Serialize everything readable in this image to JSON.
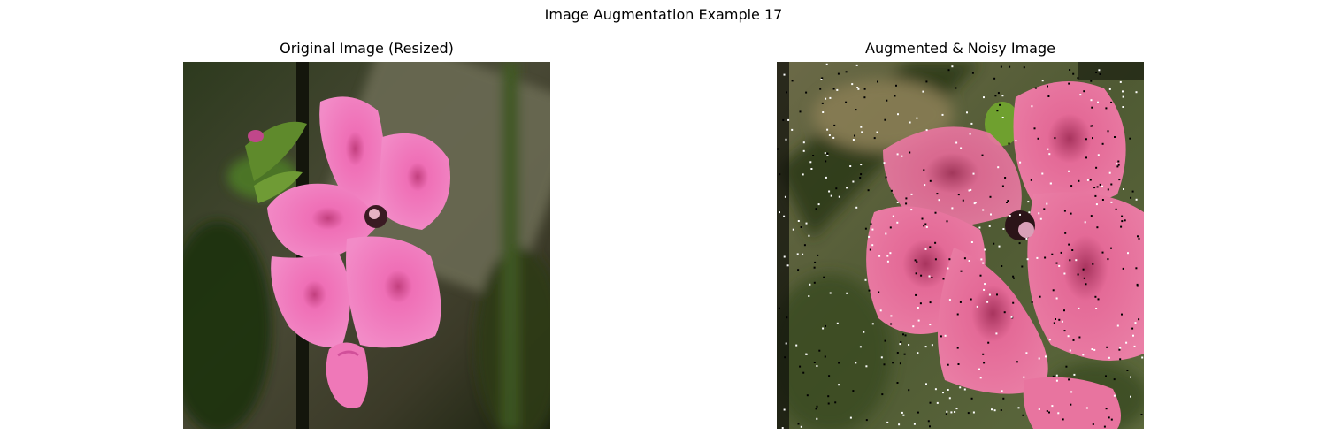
{
  "figure": {
    "suptitle": "Image Augmentation Example 17"
  },
  "panels": [
    {
      "title": "Original Image (Resized)"
    },
    {
      "title": "Augmented & Noisy Image"
    }
  ],
  "colors": {
    "petal_pink": "#f07fc0",
    "petal_dark": "#d04f98",
    "aug_petal": "#e56a96",
    "foliage_dark": "#1d2a12",
    "foliage_green": "#4d6a2a",
    "background_blur": "#6e6a4a"
  }
}
